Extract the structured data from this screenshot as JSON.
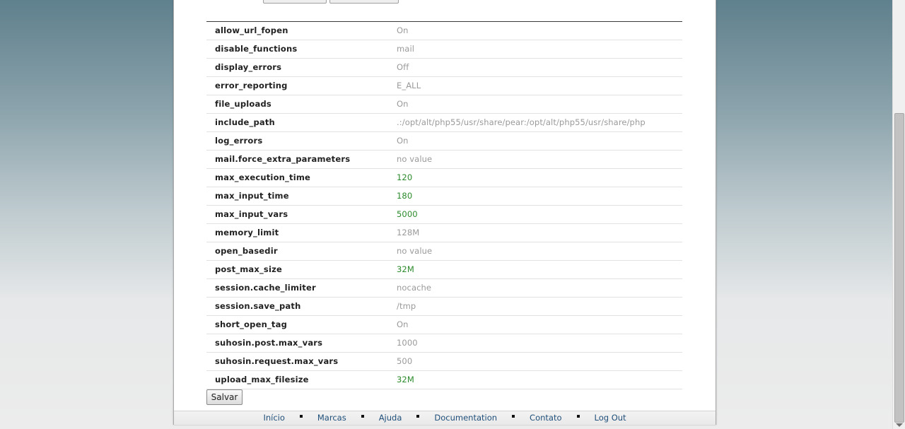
{
  "settings": {
    "rows": [
      {
        "name": "allow_url_fopen",
        "value": "On",
        "changed": false
      },
      {
        "name": "disable_functions",
        "value": "mail",
        "changed": false
      },
      {
        "name": "display_errors",
        "value": "Off",
        "changed": false
      },
      {
        "name": "error_reporting",
        "value": "E_ALL",
        "changed": false
      },
      {
        "name": "file_uploads",
        "value": "On",
        "changed": false
      },
      {
        "name": "include_path",
        "value": ".:/opt/alt/php55/usr/share/pear:/opt/alt/php55/usr/share/php",
        "changed": false
      },
      {
        "name": "log_errors",
        "value": "On",
        "changed": false
      },
      {
        "name": "mail.force_extra_parameters",
        "value": "no value",
        "changed": false
      },
      {
        "name": "max_execution_time",
        "value": "120",
        "changed": true
      },
      {
        "name": "max_input_time",
        "value": "180",
        "changed": true
      },
      {
        "name": "max_input_vars",
        "value": "5000",
        "changed": true
      },
      {
        "name": "memory_limit",
        "value": "128M",
        "changed": false
      },
      {
        "name": "open_basedir",
        "value": "no value",
        "changed": false
      },
      {
        "name": "post_max_size",
        "value": "32M",
        "changed": true
      },
      {
        "name": "session.cache_limiter",
        "value": "nocache",
        "changed": false
      },
      {
        "name": "session.save_path",
        "value": "/tmp",
        "changed": false
      },
      {
        "name": "short_open_tag",
        "value": "On",
        "changed": false
      },
      {
        "name": "suhosin.post.max_vars",
        "value": "1000",
        "changed": false
      },
      {
        "name": "suhosin.request.max_vars",
        "value": "500",
        "changed": false
      },
      {
        "name": "upload_max_filesize",
        "value": "32M",
        "changed": true
      }
    ]
  },
  "save_button": {
    "label": "Salvar"
  },
  "footer": {
    "links": [
      {
        "label": "Início"
      },
      {
        "label": "Marcas"
      },
      {
        "label": "Ajuda"
      },
      {
        "label": "Documentation"
      },
      {
        "label": "Contato"
      },
      {
        "label": "Log Out"
      }
    ]
  },
  "colors": {
    "default_value": "#9a9a9a",
    "changed_value": "#2b8a2b",
    "link": "#1f4f7a"
  }
}
